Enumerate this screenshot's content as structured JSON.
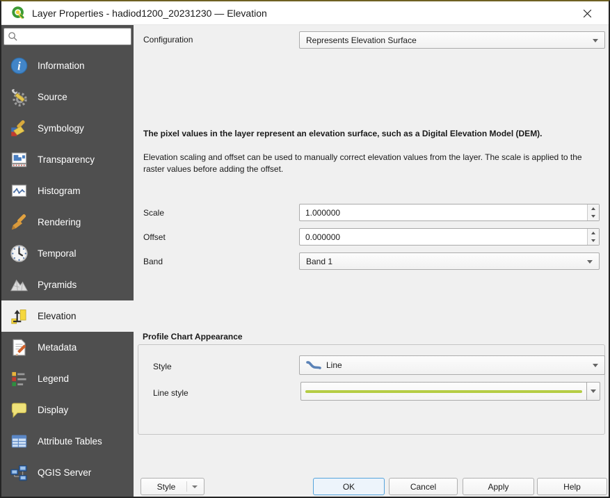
{
  "window": {
    "title": "Layer Properties - hadiod1200_20231230 — Elevation",
    "close_icon": "close-icon",
    "app_icon": "qgis-logo-icon"
  },
  "sidebar": {
    "search": {
      "value": "",
      "placeholder": "",
      "icon": "search-icon"
    },
    "items": [
      {
        "label": "Information",
        "icon": "information-icon",
        "selected": false
      },
      {
        "label": "Source",
        "icon": "source-icon",
        "selected": false
      },
      {
        "label": "Symbology",
        "icon": "symbology-icon",
        "selected": false
      },
      {
        "label": "Transparency",
        "icon": "transparency-icon",
        "selected": false
      },
      {
        "label": "Histogram",
        "icon": "histogram-icon",
        "selected": false
      },
      {
        "label": "Rendering",
        "icon": "rendering-icon",
        "selected": false
      },
      {
        "label": "Temporal",
        "icon": "temporal-icon",
        "selected": false
      },
      {
        "label": "Pyramids",
        "icon": "pyramids-icon",
        "selected": false
      },
      {
        "label": "Elevation",
        "icon": "elevation-icon",
        "selected": true
      },
      {
        "label": "Metadata",
        "icon": "metadata-icon",
        "selected": false
      },
      {
        "label": "Legend",
        "icon": "legend-icon",
        "selected": false
      },
      {
        "label": "Display",
        "icon": "display-icon",
        "selected": false
      },
      {
        "label": "Attribute Tables",
        "icon": "attribute-tables-icon",
        "selected": false
      },
      {
        "label": "QGIS Server",
        "icon": "qgis-server-icon",
        "selected": false
      }
    ]
  },
  "main": {
    "configuration": {
      "label": "Configuration",
      "value": "Represents Elevation Surface"
    },
    "description_bold": "The pixel values in the layer represent an elevation surface, such as a Digital Elevation Model (DEM).",
    "description": "Elevation scaling and offset can be used to manually correct elevation values from the layer. The scale is applied to the raster values before adding the offset.",
    "scale": {
      "label": "Scale",
      "value": "1.000000"
    },
    "offset": {
      "label": "Offset",
      "value": "0.000000"
    },
    "band": {
      "label": "Band",
      "value": "Band 1"
    },
    "profile": {
      "heading": "Profile Chart Appearance",
      "style": {
        "label": "Style",
        "value": "Line",
        "icon": "line-symbol-icon"
      },
      "line_style": {
        "label": "Line style",
        "preview": "green-line-preview",
        "line_color": "#b5cd45"
      }
    }
  },
  "footer": {
    "style_button": "Style",
    "ok": "OK",
    "cancel": "Cancel",
    "apply": "Apply",
    "help": "Help"
  },
  "colors": {
    "sidebar_bg": "#4f4f4f",
    "selected_bg": "#f0f0f0",
    "titlebar_bg": "#ffffff",
    "window_top_border": "#6e6022",
    "line_preview": "#b5cd45",
    "ok_border": "#55a4dc",
    "style_line_icon": "#5b83b7"
  }
}
